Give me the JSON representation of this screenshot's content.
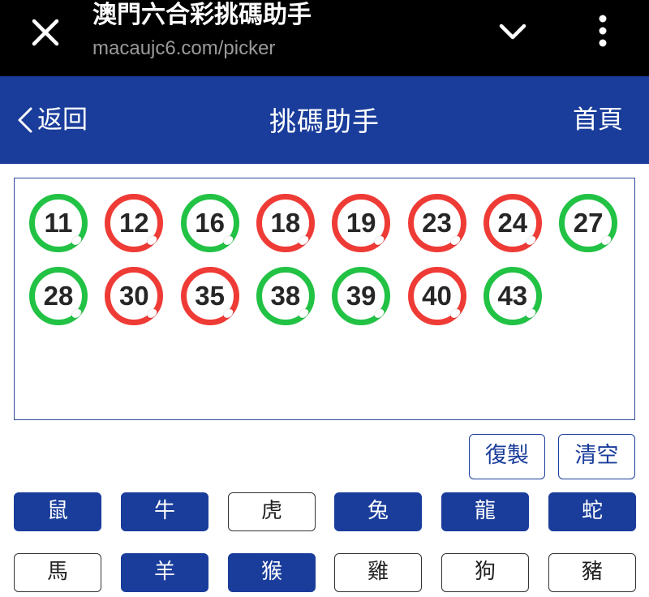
{
  "browser": {
    "title": "澳門六合彩挑碼助手",
    "url": "macaujc6.com/picker"
  },
  "header": {
    "back_label": "返回",
    "title": "挑碼助手",
    "home_label": "首頁"
  },
  "colors": {
    "primary": "#1a3d9b",
    "ball_green": "#22c245",
    "ball_red": "#ef3b36"
  },
  "selected_numbers": [
    {
      "num": "11",
      "color": "green"
    },
    {
      "num": "12",
      "color": "red"
    },
    {
      "num": "16",
      "color": "green"
    },
    {
      "num": "18",
      "color": "red"
    },
    {
      "num": "19",
      "color": "red"
    },
    {
      "num": "23",
      "color": "red"
    },
    {
      "num": "24",
      "color": "red"
    },
    {
      "num": "27",
      "color": "green"
    },
    {
      "num": "28",
      "color": "green"
    },
    {
      "num": "30",
      "color": "red"
    },
    {
      "num": "35",
      "color": "red"
    },
    {
      "num": "38",
      "color": "green"
    },
    {
      "num": "39",
      "color": "green"
    },
    {
      "num": "40",
      "color": "red"
    },
    {
      "num": "43",
      "color": "green"
    }
  ],
  "actions": {
    "copy_label": "復製",
    "clear_label": "清空"
  },
  "zodiac": [
    {
      "label": "鼠",
      "selected": true
    },
    {
      "label": "牛",
      "selected": true
    },
    {
      "label": "虎",
      "selected": false
    },
    {
      "label": "兔",
      "selected": true
    },
    {
      "label": "龍",
      "selected": true
    },
    {
      "label": "蛇",
      "selected": true
    },
    {
      "label": "馬",
      "selected": false
    },
    {
      "label": "羊",
      "selected": true
    },
    {
      "label": "猴",
      "selected": true
    },
    {
      "label": "雞",
      "selected": false
    },
    {
      "label": "狗",
      "selected": false
    },
    {
      "label": "豬",
      "selected": false
    }
  ]
}
